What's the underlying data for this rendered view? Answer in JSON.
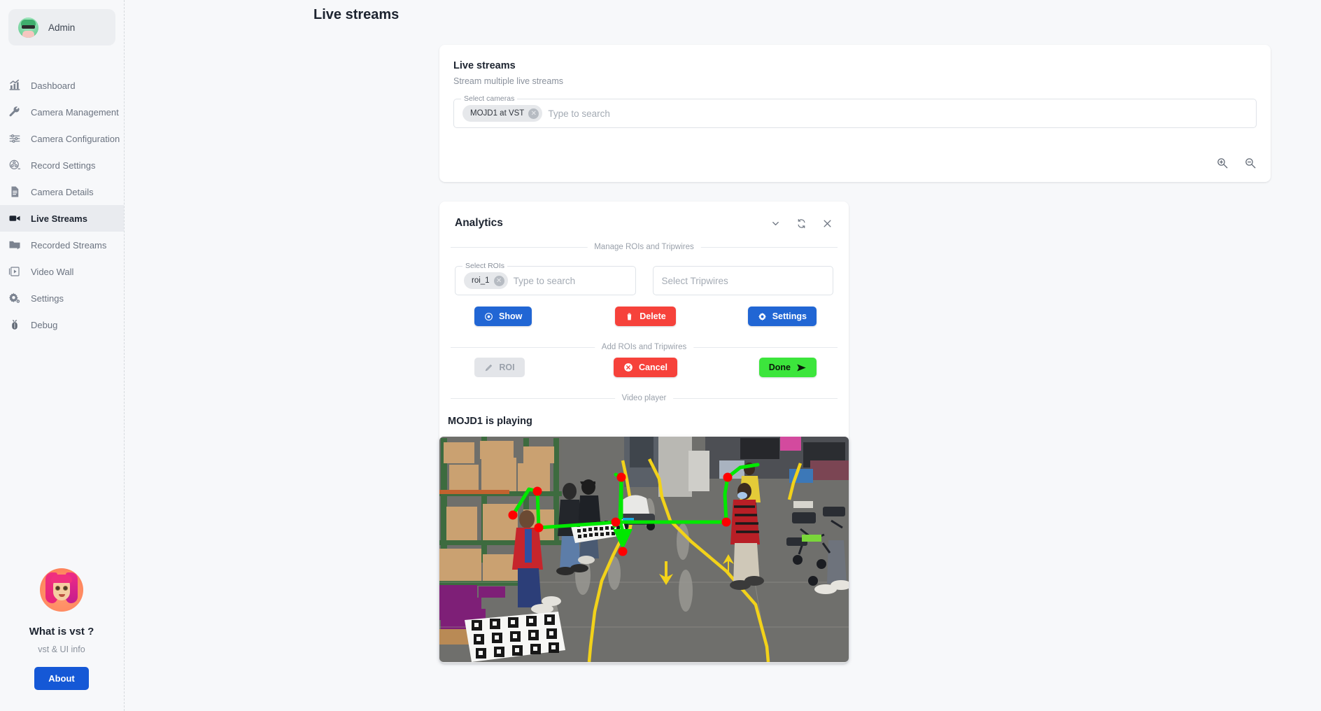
{
  "sidebar": {
    "profile": {
      "name": "Admin",
      "avatar": "admin-avatar"
    },
    "items": [
      {
        "label": "Dashboard",
        "icon": "chart-bar-icon",
        "active": false
      },
      {
        "label": "Camera Management",
        "icon": "wrench-icon",
        "active": false
      },
      {
        "label": "Camera Configuration",
        "icon": "sliders-icon",
        "active": false
      },
      {
        "label": "Record Settings",
        "icon": "film-reel-icon",
        "active": false
      },
      {
        "label": "Camera Details",
        "icon": "document-icon",
        "active": false
      },
      {
        "label": "Live Streams",
        "icon": "video-camera-icon",
        "active": true
      },
      {
        "label": "Recorded Streams",
        "icon": "folder-play-icon",
        "active": false
      },
      {
        "label": "Video Wall",
        "icon": "video-wall-icon",
        "active": false
      },
      {
        "label": "Settings",
        "icon": "gear-icon",
        "active": false
      },
      {
        "label": "Debug",
        "icon": "bug-icon",
        "active": false
      }
    ],
    "promo": {
      "title": "What is vst ?",
      "subtitle": "vst & UI info",
      "button": "About"
    }
  },
  "header": {
    "title": "Live streams"
  },
  "streams_card": {
    "title": "Live streams",
    "subtitle": "Stream multiple live streams",
    "select_cameras": {
      "legend": "Select cameras",
      "chips": [
        "MOJD1 at VST"
      ],
      "placeholder": "Type to search"
    },
    "zoom_in_icon": "zoom-in-icon",
    "zoom_out_icon": "zoom-out-icon"
  },
  "analytics_card": {
    "title": "Analytics",
    "header_actions": [
      {
        "name": "collapse-chevron-icon",
        "icon": "chevron-down-icon"
      },
      {
        "name": "refresh-icon",
        "icon": "refresh-icon"
      },
      {
        "name": "close-icon",
        "icon": "close-icon"
      }
    ],
    "manage_section_label": "Manage ROIs and Tripwires",
    "select_rois": {
      "legend": "Select ROIs",
      "chips": [
        "roi_1"
      ],
      "placeholder": "Type to search"
    },
    "select_tripwires": {
      "placeholder": "Select Tripwires"
    },
    "manage_buttons": [
      {
        "label": "Show",
        "icon": "eye-icon",
        "style": "blue"
      },
      {
        "label": "Delete",
        "icon": "trash-icon",
        "style": "red"
      },
      {
        "label": "Settings",
        "icon": "gear-icon",
        "style": "blue"
      }
    ],
    "add_section_label": "Add ROIs and Tripwires",
    "add_buttons": [
      {
        "label": "ROI",
        "icon": "pencil-icon",
        "style": "grey"
      },
      {
        "label": "Cancel",
        "icon": "cancel-circle-icon",
        "style": "red"
      },
      {
        "label": "Done",
        "icon": "send-arrow-icon",
        "style": "green"
      }
    ],
    "video_section_label": "Video player",
    "player_title": "MOJD1 is playing"
  },
  "colors": {
    "accent_blue": "#2166d4",
    "about_blue": "#1558d6",
    "danger_red": "#f6423b",
    "success_green": "#3ce53c",
    "page_bg": "#f7f8fa",
    "card_bg": "#ffffff",
    "text_primary": "#1d2430",
    "text_muted": "#8a919c",
    "roi_line": "#00e800",
    "roi_point": "#ff0000",
    "floor_tape": "#f2d21a"
  }
}
